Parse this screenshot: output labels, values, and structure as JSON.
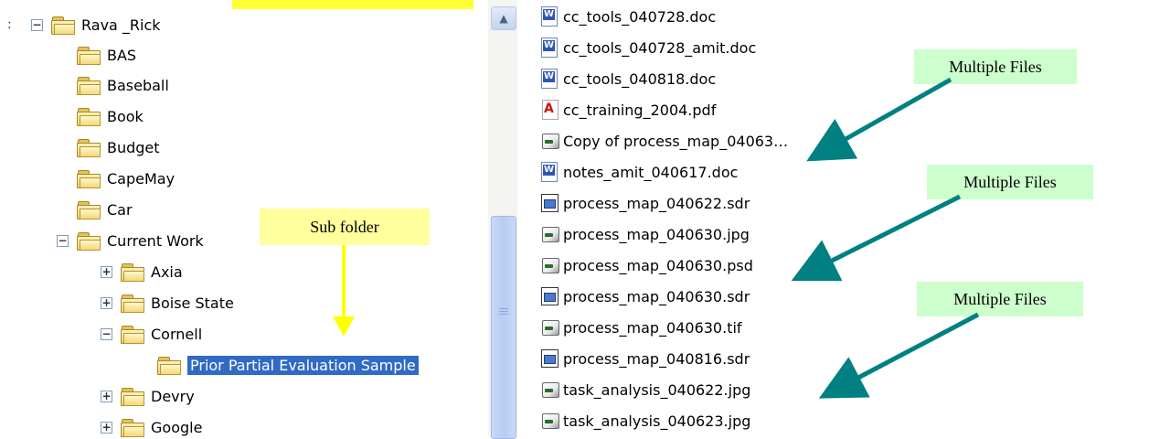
{
  "tree": {
    "root": {
      "label": "Rava _Rick",
      "expander": "⊟"
    },
    "items": [
      {
        "label": "BAS"
      },
      {
        "label": "Baseball"
      },
      {
        "label": "Book"
      },
      {
        "label": "Budget"
      },
      {
        "label": "CapeMay"
      },
      {
        "label": "Car"
      },
      {
        "label": "Current Work",
        "expander": "−"
      },
      {
        "label": "Axia",
        "expander": "+"
      },
      {
        "label": "Boise State",
        "expander": "+"
      },
      {
        "label": "Cornell",
        "expander": "−"
      },
      {
        "label": "Prior Partial Evaluation Sample",
        "selected": true
      },
      {
        "label": "Devry",
        "expander": "+"
      },
      {
        "label": "Google",
        "expander": "+"
      }
    ]
  },
  "callouts": {
    "sub_folder": "Sub folder",
    "multiple_files_1": "Multiple Files",
    "multiple_files_2": "Multiple Files",
    "multiple_files_3": "Multiple Files"
  },
  "files": [
    {
      "name": "cc_tools_040728.doc",
      "icon": "word-doc-icon"
    },
    {
      "name": "cc_tools_040728_amit.doc",
      "icon": "word-doc-icon"
    },
    {
      "name": "cc_tools_040818.doc",
      "icon": "word-doc-icon"
    },
    {
      "name": "cc_training_2004.pdf",
      "icon": "pdf-icon"
    },
    {
      "name": "Copy of process_map_04063…",
      "icon": "image-file-icon"
    },
    {
      "name": "notes_amit_040617.doc",
      "icon": "word-doc-icon"
    },
    {
      "name": "process_map_040622.sdr",
      "icon": "sdr-file-icon"
    },
    {
      "name": "process_map_040630.jpg",
      "icon": "image-file-icon"
    },
    {
      "name": "process_map_040630.psd",
      "icon": "image-file-icon"
    },
    {
      "name": "process_map_040630.sdr",
      "icon": "sdr-file-icon"
    },
    {
      "name": "process_map_040630.tif",
      "icon": "image-file-icon"
    },
    {
      "name": "process_map_040816.sdr",
      "icon": "sdr-file-icon"
    },
    {
      "name": "task_analysis_040622.jpg",
      "icon": "image-file-icon"
    },
    {
      "name": "task_analysis_040623.jpg",
      "icon": "image-file-icon"
    }
  ],
  "scrollbar": {
    "up_arrow": "▲"
  },
  "colors": {
    "selection": "#316ac5",
    "sub_folder_callout": "#ffff9e",
    "multiple_files_callout": "#ccffcc",
    "arrow_teal": "#008080",
    "arrow_yellow": "#ffff00"
  }
}
